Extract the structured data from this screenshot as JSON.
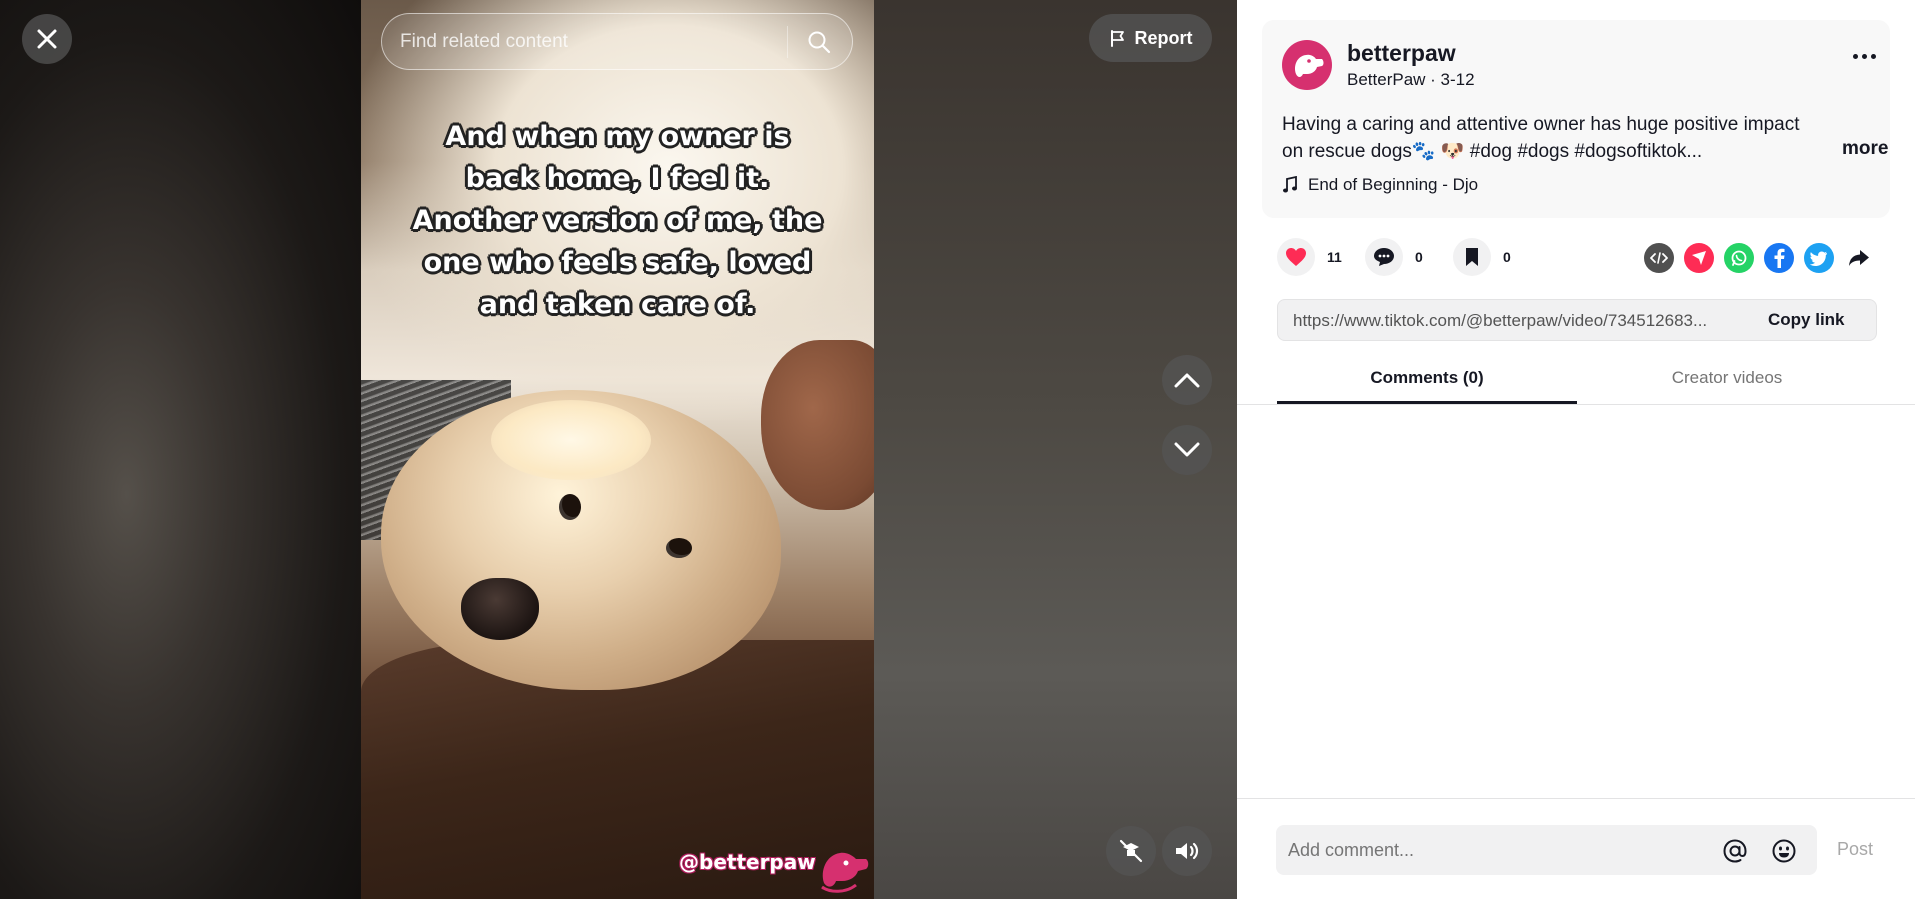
{
  "video": {
    "caption_lines": [
      "And when my owner is",
      "back home, I feel it.",
      "Another version of me, the",
      "one who feels safe, loved",
      "and taken care of."
    ],
    "watermark": "@betterpaw"
  },
  "search": {
    "placeholder": "Find related content"
  },
  "report": {
    "label": "Report"
  },
  "author": {
    "username": "betterpaw",
    "nickname_date": "BetterPaw · 3-12"
  },
  "description": {
    "line1": "Having a caring and attentive owner has huge positive impact",
    "line2": "on rescue dogs🐾 🐶 #dog #dogs #dogsoftiktok...",
    "more_label": "more"
  },
  "music": {
    "title": "End of Beginning - Djo"
  },
  "stats": {
    "likes": "11",
    "comments": "0",
    "favorites": "0"
  },
  "link": {
    "url": "https://www.tiktok.com/@betterpaw/video/734512683...",
    "copy_label": "Copy link"
  },
  "tabs": [
    {
      "label": "Comments (0)"
    },
    {
      "label": "Creator videos"
    }
  ],
  "composer": {
    "placeholder": "Add comment...",
    "post_label": "Post"
  },
  "colors": {
    "brand": "#d6306f",
    "like": "#fe2c55",
    "embed": "#505050",
    "send": "#fe2c55",
    "whatsapp": "#25d366",
    "facebook": "#1877f2",
    "twitter": "#1da1f2"
  }
}
